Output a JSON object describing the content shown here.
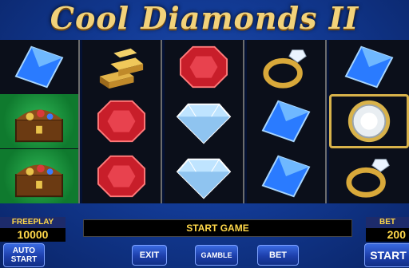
{
  "game": {
    "title": "Cool Diamonds II"
  },
  "reels": [
    [
      "blue-gem-icon",
      "treasure-chest-icon",
      "treasure-chest-icon"
    ],
    [
      "gold-bars-icon",
      "ruby-icon",
      "ruby-icon"
    ],
    [
      "ruby-icon",
      "diamond-icon",
      "diamond-icon"
    ],
    [
      "gold-ring-icon",
      "blue-gem-icon",
      "blue-gem-icon"
    ],
    [
      "blue-gem-icon",
      "round-diamond-icon",
      "gold-ring-icon"
    ]
  ],
  "panel": {
    "freeplay_label": "FREEPLAY",
    "freeplay_value": "10000",
    "bet_label": "BET",
    "bet_value": "200",
    "status": "START GAME"
  },
  "buttons": {
    "auto_start": "AUTO START",
    "exit": "EXIT",
    "gamble": "GAMBLE",
    "bet": "BET",
    "start": "START"
  },
  "colors": {
    "accent": "#ffd84a",
    "background": "#123a94"
  }
}
